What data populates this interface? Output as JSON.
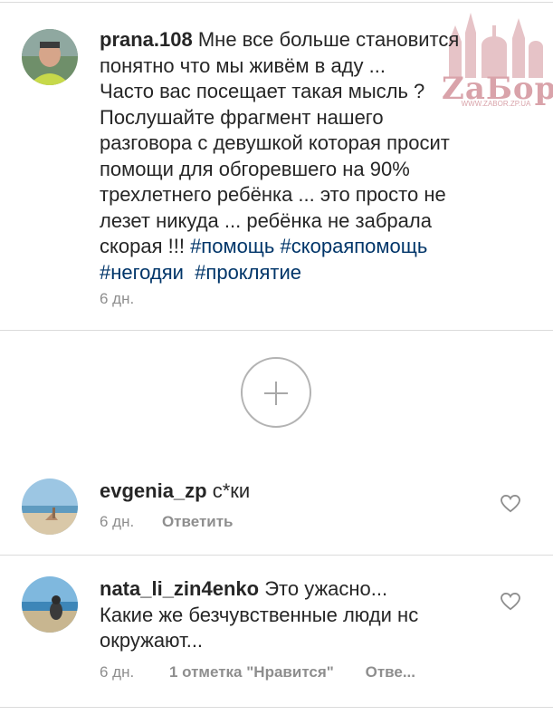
{
  "post": {
    "username": "prana.108",
    "lines": [
      "Мне все больше становится",
      "понятно что мы живём в аду ...",
      "Часто вас посещает такая мысль ?",
      "Послушайте фрагмент нашего",
      "разговора с девушкой которая просит",
      "помощи для обгоревшего на 90%",
      "трехлетнего ребёнка ... это просто не",
      "лезет никуда ... ребёнка не забрала",
      "скорая !!! "
    ],
    "hashtags": [
      "#помощь",
      "#скораяпомощь",
      "#негодяи",
      "#проклятие"
    ],
    "time": "6 дн."
  },
  "load_more": {
    "icon": "plus-circle-icon"
  },
  "comments": [
    {
      "username": "evgenia_zp",
      "text": "с*ки",
      "time": "6 дн.",
      "reply_label": "Ответить"
    },
    {
      "username": "nata_li_zin4enko",
      "text_line1": "Это ужасно...",
      "text_line2": "Какие же безчувственные люди нс",
      "text_line3": "окружают...",
      "time": "6 дн.",
      "likes_label": "1 отметка \"Нравится\"",
      "reply_label": "Отве..."
    }
  ],
  "watermark": {
    "logo_text": "ZaБор",
    "url": "WWW.ZABOR.ZP.UA"
  },
  "colors": {
    "text": "#262626",
    "meta": "#8e8e8e",
    "hashtag": "#003569",
    "divider": "#dbdbdb"
  }
}
